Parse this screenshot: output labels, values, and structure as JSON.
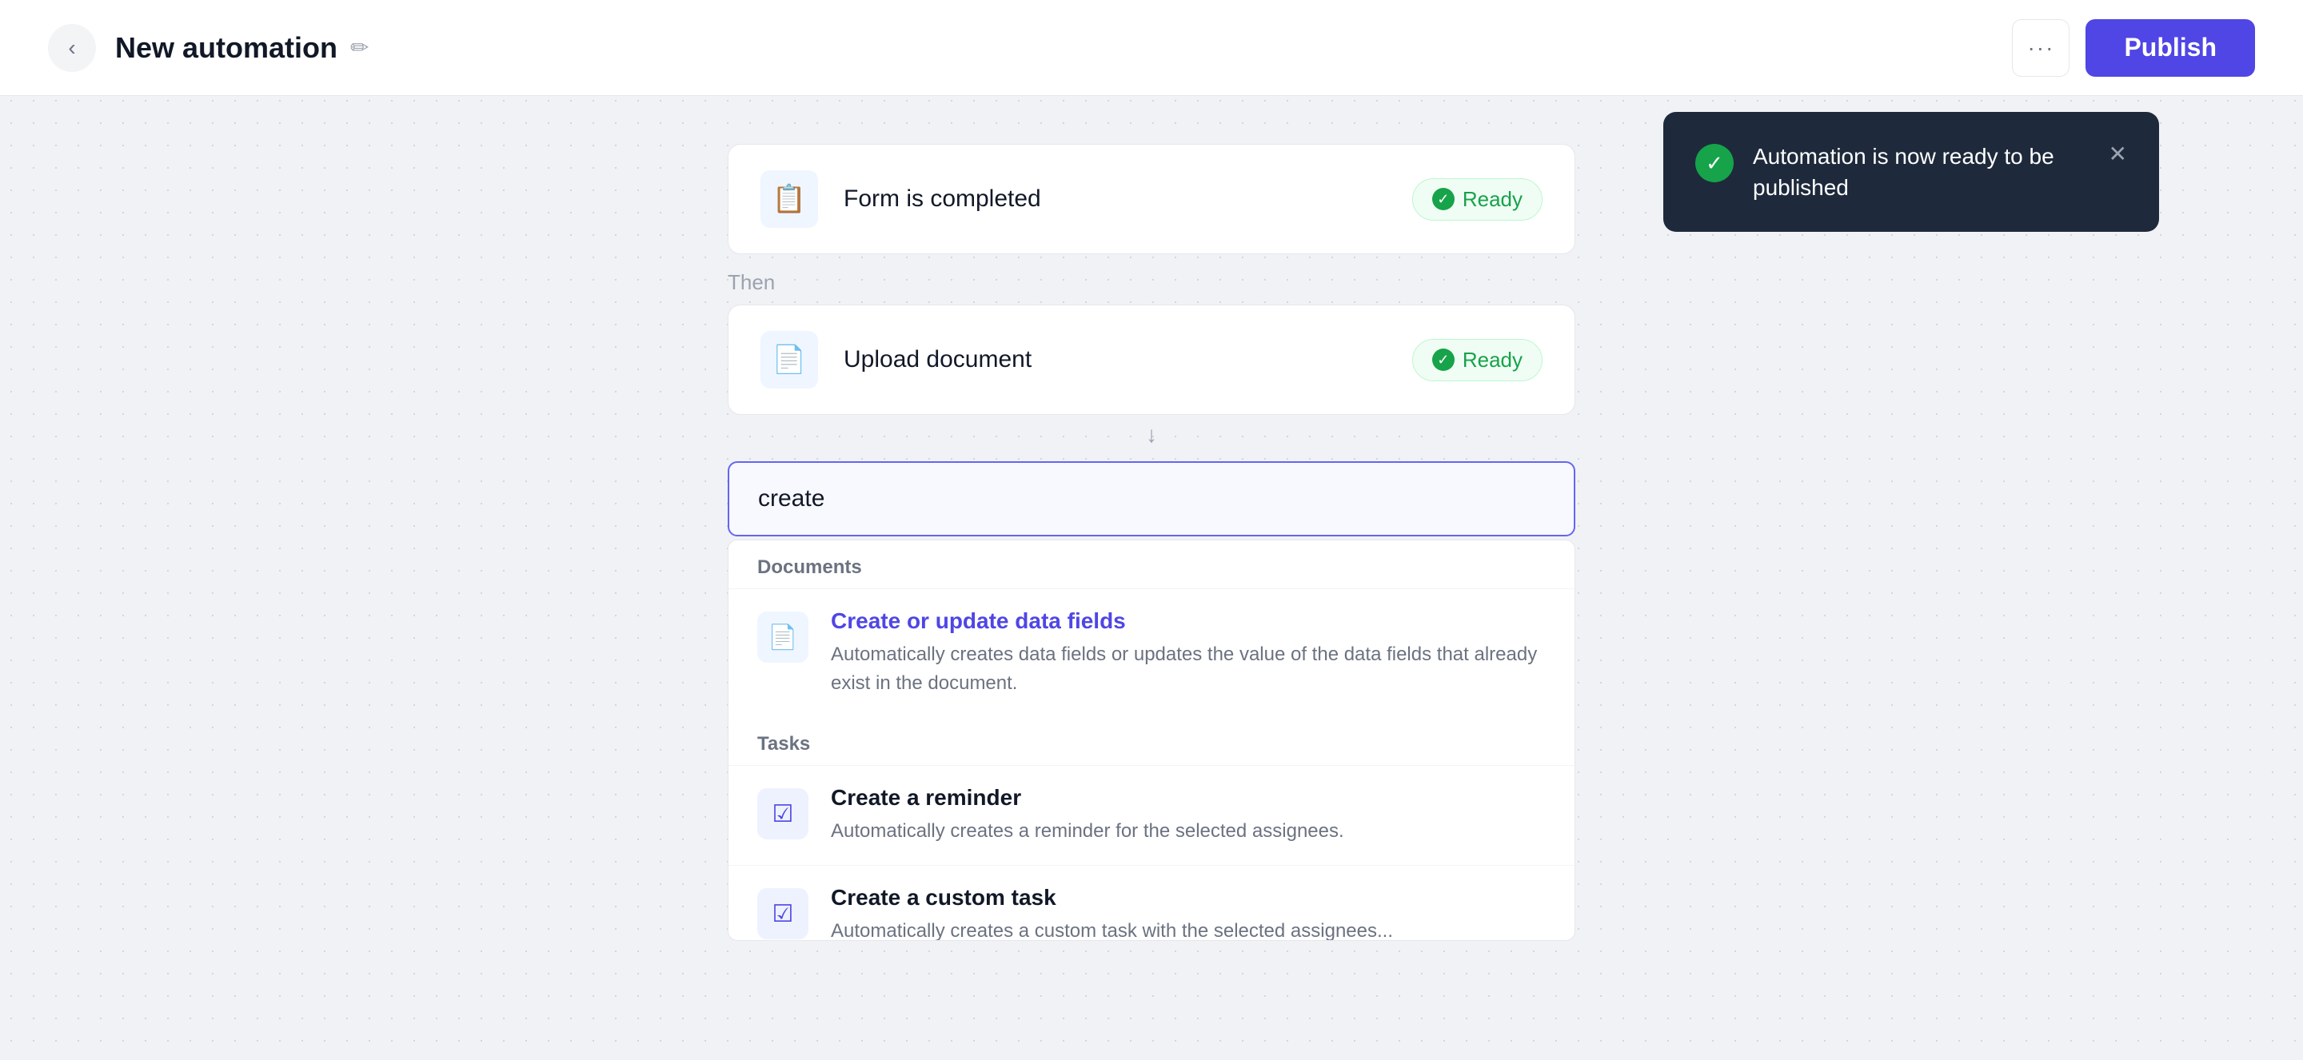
{
  "header": {
    "title": "New automation",
    "back_label": "←",
    "edit_icon": "✏",
    "more_label": "···",
    "publish_label": "Publish"
  },
  "trigger_card": {
    "icon": "📋",
    "label": "Form is completed",
    "badge_label": "Ready"
  },
  "then_label": "Then",
  "action_card": {
    "icon": "📄",
    "label": "Upload document",
    "badge_label": "Ready"
  },
  "arrow": "↓",
  "search_input": {
    "value": "create",
    "placeholder": ""
  },
  "dropdown": {
    "sections": [
      {
        "id": "documents",
        "header": "Documents",
        "items": [
          {
            "id": "create-update-data-fields",
            "title": "Create or update data fields",
            "description": "Automatically creates data fields or updates the value of the data fields that already exist in the document.",
            "icon": "📄",
            "icon_type": "doc"
          }
        ]
      },
      {
        "id": "tasks",
        "header": "Tasks",
        "items": [
          {
            "id": "create-reminder",
            "title": "Create a reminder",
            "description": "Automatically creates a reminder for the selected assignees.",
            "icon": "☑",
            "icon_type": "task"
          },
          {
            "id": "create-custom-task",
            "title": "Create a custom task",
            "description": "Automatically creates a custom task with the selected assignees...",
            "icon": "☑",
            "icon_type": "task"
          }
        ]
      }
    ]
  },
  "toast": {
    "text": "Automation is now ready to be published",
    "close_icon": "✕"
  },
  "colors": {
    "accent": "#4f46e5",
    "success": "#16a34a",
    "toast_bg": "#1e2a3b"
  }
}
